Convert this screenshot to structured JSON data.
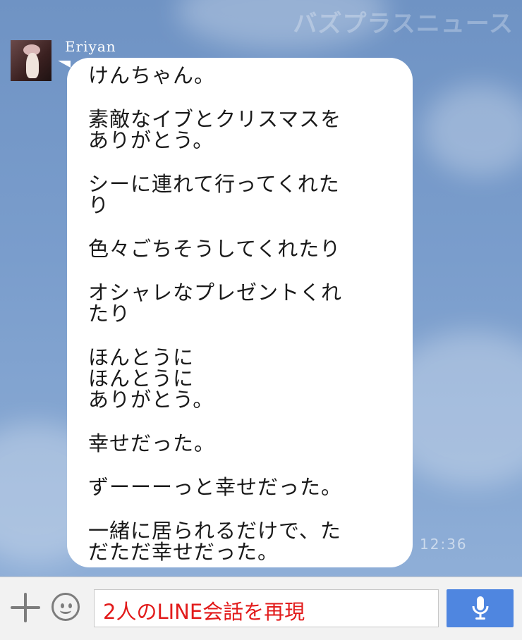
{
  "watermark": "バズプラスニュース",
  "chat": {
    "sender": "Eriyan",
    "message_lines": [
      "けんちゃん。",
      "",
      "素敵なイブとクリスマスを",
      "ありがとう。",
      "",
      "シーに連れて行ってくれた",
      "り",
      "",
      "色々ごちそうしてくれたり",
      "",
      "オシャレなプレゼントくれ",
      "たり",
      "",
      "ほんとうに",
      "ほんとうに",
      "ありがとう。",
      "",
      "幸せだった。",
      "",
      "ずーーーっと幸せだった。",
      "",
      "一緒に居られるだけで、た",
      "だただ幸せだった。"
    ],
    "time": "12:36"
  },
  "footer": {
    "plus_icon": "plus-icon",
    "emoji_icon": "smiley-icon",
    "input_value": "2人のLINE会話を再現",
    "mic_icon": "microphone-icon"
  },
  "colors": {
    "accent": "#4f86e0",
    "input_text": "#e21b1b",
    "background": "#7a9dcc"
  }
}
